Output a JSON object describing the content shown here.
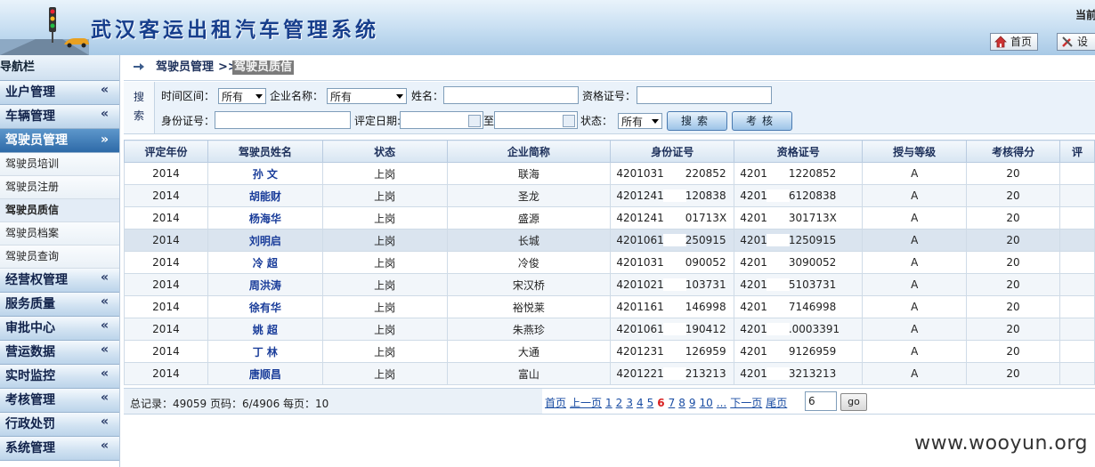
{
  "header": {
    "title": "武汉客运出租汽车管理系统",
    "current_user_label": "当前",
    "home_button": "首页",
    "settings_button": "设"
  },
  "sidebar": {
    "title": "导航栏",
    "groups": [
      {
        "label": "业户管理"
      },
      {
        "label": "车辆管理"
      },
      {
        "label": "驾驶员管理",
        "active": true,
        "items": [
          "驾驶员培训",
          "驾驶员注册",
          "驾驶员质信",
          "驾驶员档案",
          "驾驶员查询"
        ]
      },
      {
        "label": "经营权管理"
      },
      {
        "label": "服务质量"
      },
      {
        "label": "审批中心"
      },
      {
        "label": "营运数据"
      },
      {
        "label": "实时监控"
      },
      {
        "label": "考核管理"
      },
      {
        "label": "行政处罚"
      },
      {
        "label": "系统管理"
      }
    ]
  },
  "breadcrumb": {
    "parent": "驾驶员管理",
    "separator": ">>",
    "current": "驾驶员质信"
  },
  "search": {
    "side_label": [
      "搜",
      "索"
    ],
    "period_label": "时间区间：",
    "period_value": "所有",
    "company_label": "企业名称：",
    "company_value": "所有",
    "name_label": "姓名：",
    "name_value": "",
    "cert_label": "资格证号：",
    "cert_value": "",
    "idcard_label": "身份证号：",
    "idcard_value": "",
    "date_label": "评定日期:",
    "date_to": "至",
    "status_label": "状态：",
    "status_value": "所有",
    "search_button": "搜索",
    "assess_button": "考核"
  },
  "table": {
    "columns": [
      "评定年份",
      "驾驶员姓名",
      "状态",
      "企业简称",
      "身份证号",
      "资格证号",
      "授与等级",
      "考核得分",
      "评"
    ],
    "rows": [
      {
        "year": "2014",
        "name": "孙 文",
        "status": "上岗",
        "company": "联海",
        "id_a": "4201031",
        "id_b": "220852",
        "cert_a": "4201",
        "cert_b": "1220852",
        "grade": "A",
        "score": "20"
      },
      {
        "year": "2014",
        "name": "胡能财",
        "status": "上岗",
        "company": "圣龙",
        "id_a": "4201241",
        "id_b": "120838",
        "cert_a": "4201",
        "cert_b": "6120838",
        "grade": "A",
        "score": "20"
      },
      {
        "year": "2014",
        "name": "杨海华",
        "status": "上岗",
        "company": "盛源",
        "id_a": "4201241",
        "id_b": "01713X",
        "cert_a": "4201",
        "cert_b": "301713X",
        "grade": "A",
        "score": "20"
      },
      {
        "year": "2014",
        "name": "刘明启",
        "status": "上岗",
        "company": "长城",
        "id_a": "4201061",
        "id_b": "250915",
        "cert_a": "4201",
        "cert_b": "1250915",
        "grade": "A",
        "score": "20"
      },
      {
        "year": "2014",
        "name": "冷 超",
        "status": "上岗",
        "company": "冷俊",
        "id_a": "4201031",
        "id_b": "090052",
        "cert_a": "4201",
        "cert_b": "3090052",
        "grade": "A",
        "score": "20"
      },
      {
        "year": "2014",
        "name": "周洪涛",
        "status": "上岗",
        "company": "宋汉桥",
        "id_a": "4201021",
        "id_b": "103731",
        "cert_a": "4201",
        "cert_b": "5103731",
        "grade": "A",
        "score": "20"
      },
      {
        "year": "2014",
        "name": "徐有华",
        "status": "上岗",
        "company": "裕悦莱",
        "id_a": "4201161",
        "id_b": "146998",
        "cert_a": "4201",
        "cert_b": "7146998",
        "grade": "A",
        "score": "20"
      },
      {
        "year": "2014",
        "name": "姚 超",
        "status": "上岗",
        "company": "朱燕珍",
        "id_a": "4201061",
        "id_b": "190412",
        "cert_a": "4201",
        "cert_b": ".0003391",
        "grade": "A",
        "score": "20"
      },
      {
        "year": "2014",
        "name": "丁 林",
        "status": "上岗",
        "company": "大通",
        "id_a": "4201231",
        "id_b": "126959",
        "cert_a": "4201",
        "cert_b": "9126959",
        "grade": "A",
        "score": "20"
      },
      {
        "year": "2014",
        "name": "唐顺昌",
        "status": "上岗",
        "company": "富山",
        "id_a": "4201221",
        "id_b": "213213",
        "cert_a": "4201",
        "cert_b": "3213213",
        "grade": "A",
        "score": "20"
      }
    ]
  },
  "pager": {
    "summary": "总记录：49059 页码：6/4906 每页：10",
    "first": "首页",
    "prev": "上一页",
    "pages": [
      "1",
      "2",
      "3",
      "4",
      "5",
      "6",
      "7",
      "8",
      "9",
      "10",
      "..."
    ],
    "current_page": "6",
    "next": "下一页",
    "last": "尾页",
    "input_value": "6",
    "go": "go"
  },
  "watermark": "www.wooyun.org",
  "colors": {
    "nav_active": "#2e6aa8",
    "current_page": "#d82020",
    "link": "#1a4da3"
  }
}
